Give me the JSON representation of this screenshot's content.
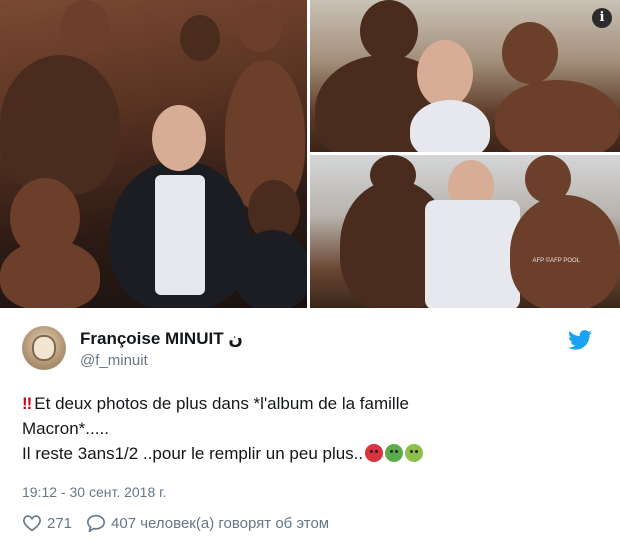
{
  "media": {
    "photo_main_alt": "",
    "photo_top_right_alt": "",
    "photo_bottom_right_alt": "",
    "watermark": "AFP ©AFP POOL",
    "info_glyph": "i"
  },
  "author": {
    "name": "Françoise MINUIT ",
    "name_suffix": "ن",
    "handle": "@f_minuit",
    "avatar_icon": "avatar"
  },
  "tweet": {
    "bang": "‼",
    "line1": "Et deux photos de plus dans *l'album de la famille",
    "line2": "Macron*.....",
    "line3": "Il reste 3ans1/2 ..pour le remplir un peu plus..",
    "emojis": [
      "angry-face",
      "nauseated-face",
      "vomiting-face"
    ],
    "timestamp": "19:12 - 30 сент. 2018 г."
  },
  "actions": {
    "likes": "271",
    "replies_text": "407 человек(а) говорят об этом"
  },
  "colors": {
    "twitter_blue": "#1da1f2",
    "secondary_text": "#657786",
    "primary_text": "#14171a"
  }
}
